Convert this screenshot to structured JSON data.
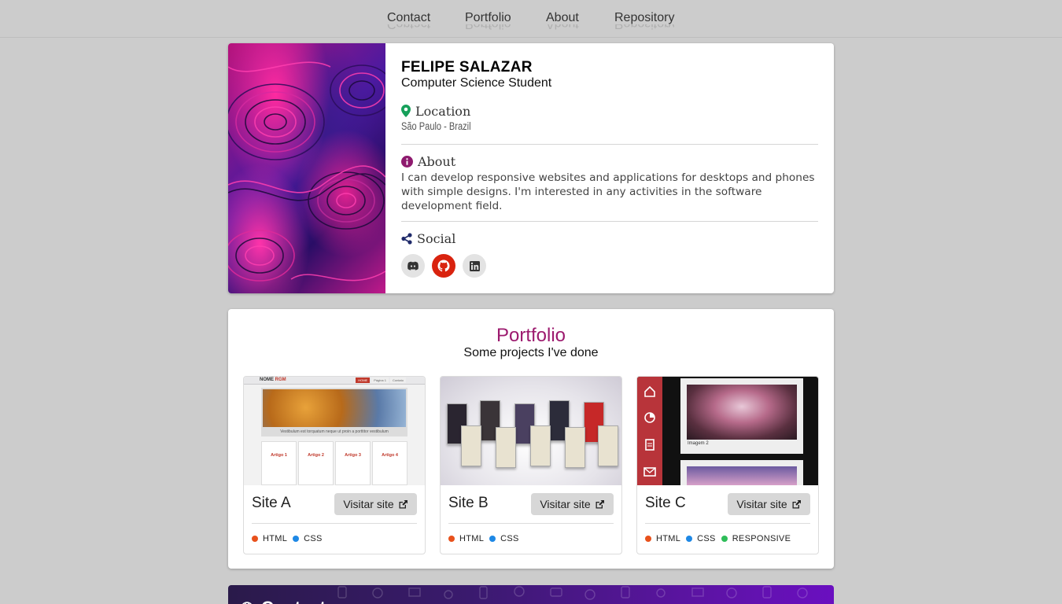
{
  "nav": {
    "items": [
      {
        "label": "Contact"
      },
      {
        "label": "Portfolio"
      },
      {
        "label": "About"
      },
      {
        "label": "Repository"
      }
    ]
  },
  "profile": {
    "name": "FELIPE SALAZAR",
    "title": "Computer Science Student",
    "location_heading": "Location",
    "location_value": "São Paulo - Brazil",
    "about_heading": "About",
    "about_text": "I can develop responsive websites and applications for desktops and phones with simple designs. I'm interested in any activities in the software development field.",
    "social_heading": "Social",
    "social_links": [
      {
        "icon": "discord-icon"
      },
      {
        "icon": "github-icon"
      },
      {
        "icon": "linkedin-icon"
      }
    ]
  },
  "portfolio": {
    "title": "Portfolio",
    "subtitle": "Some projects I've done",
    "projects": [
      {
        "name": "Site A",
        "button": "Visitar site",
        "tags": [
          {
            "label": "HTML",
            "color": "#e8511c"
          },
          {
            "label": "CSS",
            "color": "#1e88e5"
          }
        ],
        "thumb": {
          "logo": "NOME",
          "logo_accent": "RGM",
          "menu": [
            "HOME",
            "Página 1",
            "Contato"
          ],
          "band": "Vestibulum est torquatum neque ut proin a porttitor vestibulum",
          "columns": [
            "Artigo 1",
            "Artigo 2",
            "Artigo 3",
            "Artigo 4"
          ]
        }
      },
      {
        "name": "Site B",
        "button": "Visitar site",
        "tags": [
          {
            "label": "HTML",
            "color": "#e8511c"
          },
          {
            "label": "CSS",
            "color": "#1e88e5"
          }
        ]
      },
      {
        "name": "Site C",
        "button": "Visitar site",
        "tags": [
          {
            "label": "HTML",
            "color": "#e8511c"
          },
          {
            "label": "CSS",
            "color": "#1e88e5"
          },
          {
            "label": "RESPONSIVE",
            "color": "#2ebd59"
          }
        ],
        "thumb": {
          "caption": "Imagem 2"
        }
      }
    ]
  },
  "contact": {
    "title": "Contact"
  },
  "colors": {
    "accent": "#9c1a6e",
    "location_icon": "#16a05a",
    "about_icon": "#8e1a6e",
    "social_icon": "#1f2a6a",
    "github_bg": "#d9230f"
  }
}
